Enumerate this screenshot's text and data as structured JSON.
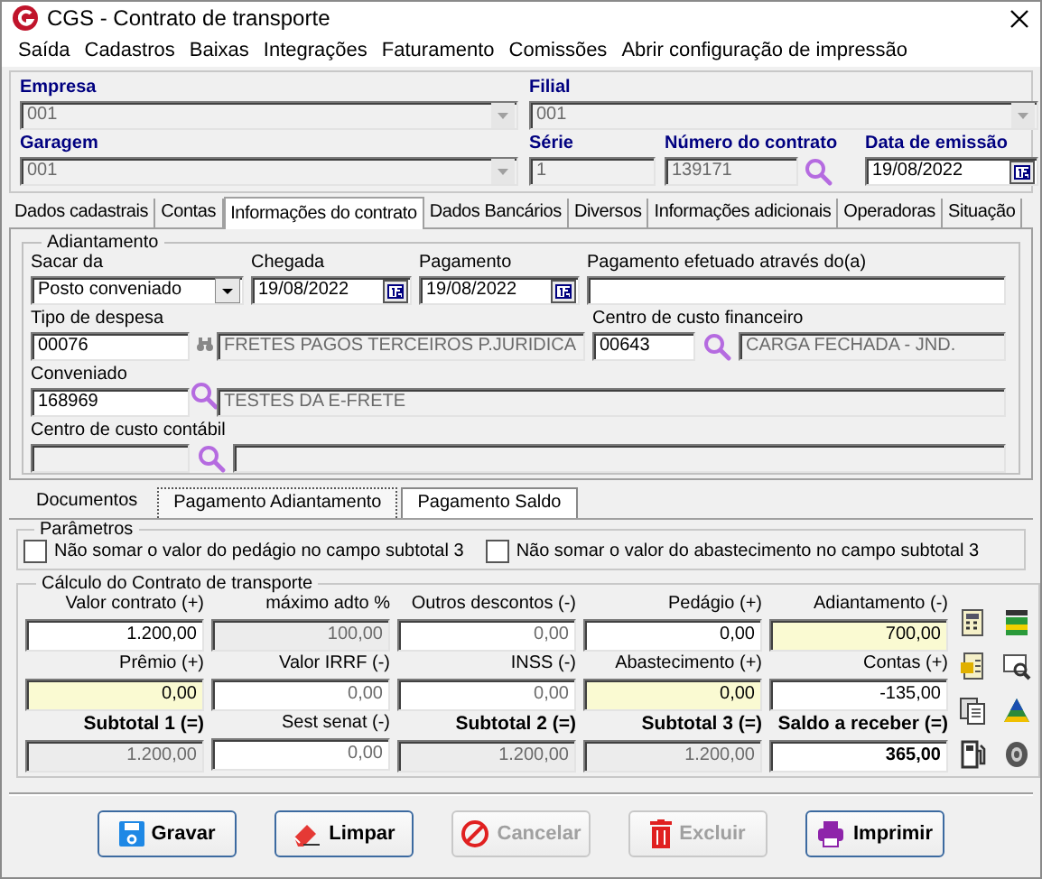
{
  "window": {
    "title": "CGS - Contrato de transporte"
  },
  "menu": [
    "Saída",
    "Cadastros",
    "Baixas",
    "Integrações",
    "Faturamento",
    "Comissões",
    "Abrir configuração de impressão"
  ],
  "header": {
    "empresa": {
      "label": "Empresa",
      "value": "001"
    },
    "filial": {
      "label": "Filial",
      "value": "001"
    },
    "garagem": {
      "label": "Garagem",
      "value": "001"
    },
    "serie": {
      "label": "Série",
      "value": "1"
    },
    "numero": {
      "label": "Número do contrato",
      "value": "139171"
    },
    "data": {
      "label": "Data de emissão",
      "value": "19/08/2022"
    }
  },
  "tabs": [
    {
      "label": "Dados cadastrais",
      "selected": false
    },
    {
      "label": "Contas",
      "selected": false
    },
    {
      "label": "Informações do contrato",
      "selected": true
    },
    {
      "label": "Dados Bancários",
      "selected": false
    },
    {
      "label": "Diversos",
      "selected": false
    },
    {
      "label": "Informações adicionais",
      "selected": false
    },
    {
      "label": "Operadoras",
      "selected": false
    },
    {
      "label": "Situação",
      "selected": false
    }
  ],
  "adiantamento": {
    "title": "Adiantamento",
    "sacar_da": {
      "label": "Sacar da",
      "value": "Posto conveniado"
    },
    "chegada": {
      "label": "Chegada",
      "value": "19/08/2022"
    },
    "pagamento": {
      "label": "Pagamento",
      "value": "19/08/2022"
    },
    "pagamento_efetuado": {
      "label": "Pagamento efetuado através do(a)"
    },
    "tipo_despesa": {
      "label": "Tipo de despesa",
      "value": "00076",
      "description": "FRETES PAGOS TERCEIROS P.JURIDICA"
    },
    "centro_custo_financeiro": {
      "label": "Centro de custo financeiro",
      "value": "00643",
      "description": "CARGA FECHADA - JND."
    },
    "conveniado": {
      "label": "Conveniado",
      "value": "168969",
      "description": "TESTES DA E-FRETE"
    },
    "centro_custo_contabil": {
      "label": "Centro de custo contábil"
    }
  },
  "subtabs": [
    {
      "label": "Documentos",
      "selected": false
    },
    {
      "label": "Pagamento Adiantamento",
      "selected": true
    },
    {
      "label": "Pagamento Saldo",
      "selected": false
    }
  ],
  "parametros": {
    "title": "Parâmetros",
    "options": [
      {
        "label": "Não somar o valor do pedágio no campo subtotal 3",
        "checked": false
      },
      {
        "label": "Não somar o valor do abastecimento no campo subtotal 3",
        "checked": false
      }
    ]
  },
  "calculo": {
    "title": "Cálculo do Contrato de transporte",
    "fields": [
      {
        "label": "Valor contrato (+)",
        "value": "1.200,00",
        "kind": "input"
      },
      {
        "label": "máximo adto %",
        "value": "100,00",
        "kind": "readonly"
      },
      {
        "label": "Outros descontos (-)",
        "value": "0,00",
        "kind": "muted"
      },
      {
        "label": "Pedágio (+)",
        "value": "0,00",
        "kind": "input"
      },
      {
        "label": "Adiantamento (-)",
        "value": "700,00",
        "kind": "highlight"
      },
      {
        "label": "Prêmio (+)",
        "value": "0,00",
        "kind": "highlight"
      },
      {
        "label": "Valor IRRF (-)",
        "value": "0,00",
        "kind": "muted"
      },
      {
        "label": "INSS (-)",
        "value": "0,00",
        "kind": "muted"
      },
      {
        "label": "Abastecimento (+)",
        "value": "0,00",
        "kind": "highlight"
      },
      {
        "label": "Contas (+)",
        "value": "-135,00",
        "kind": "input"
      },
      {
        "label": "Subtotal 1 (=)",
        "value": "1.200,00",
        "kind": "subtotal"
      },
      {
        "label": "Sest senat (-)",
        "value": "0,00",
        "kind": "muted"
      },
      {
        "label": "Subtotal 2 (=)",
        "value": "1.200,00",
        "kind": "subtotal"
      },
      {
        "label": "Subtotal 3 (=)",
        "value": "1.200,00",
        "kind": "subtotal"
      },
      {
        "label": "Saldo a receber (=)",
        "value": "365,00",
        "kind": "balance"
      }
    ]
  },
  "buttons": [
    {
      "label": "Gravar",
      "disabled": false
    },
    {
      "label": "Limpar",
      "disabled": false
    },
    {
      "label": "Cancelar",
      "disabled": true
    },
    {
      "label": "Excluir",
      "disabled": true
    },
    {
      "label": "Imprimir",
      "disabled": false
    }
  ]
}
